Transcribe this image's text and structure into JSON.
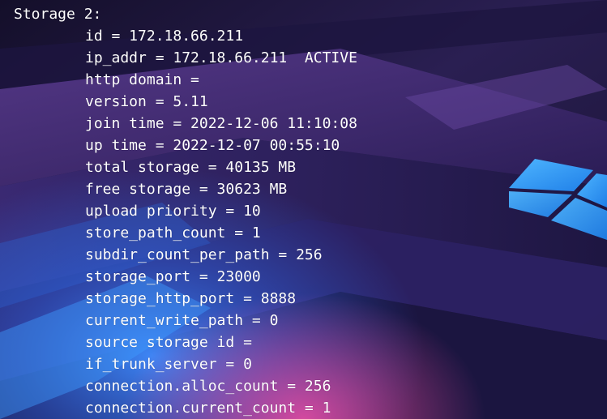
{
  "terminal": {
    "header": "Storage 2:",
    "lines": [
      "id = 172.18.66.211",
      "ip_addr = 172.18.66.211  ACTIVE",
      "http domain =",
      "version = 5.11",
      "join time = 2022-12-06 11:10:08",
      "up time = 2022-12-07 00:55:10",
      "total storage = 40135 MB",
      "free storage = 30623 MB",
      "upload priority = 10",
      "store_path_count = 1",
      "subdir_count_per_path = 256",
      "storage_port = 23000",
      "storage_http_port = 8888",
      "current_write_path = 0",
      "source storage id =",
      "if_trunk_server = 0",
      "connection.alloc_count = 256",
      "connection.current_count = 1"
    ]
  },
  "wallpaper": {
    "icon": "windows-logo-icon",
    "colors": {
      "base": "#14102a",
      "purple": "#4a2f7a",
      "blue": "#2f7dff",
      "logo": "#3aa0ff",
      "glow": "#ff4fa8"
    }
  }
}
